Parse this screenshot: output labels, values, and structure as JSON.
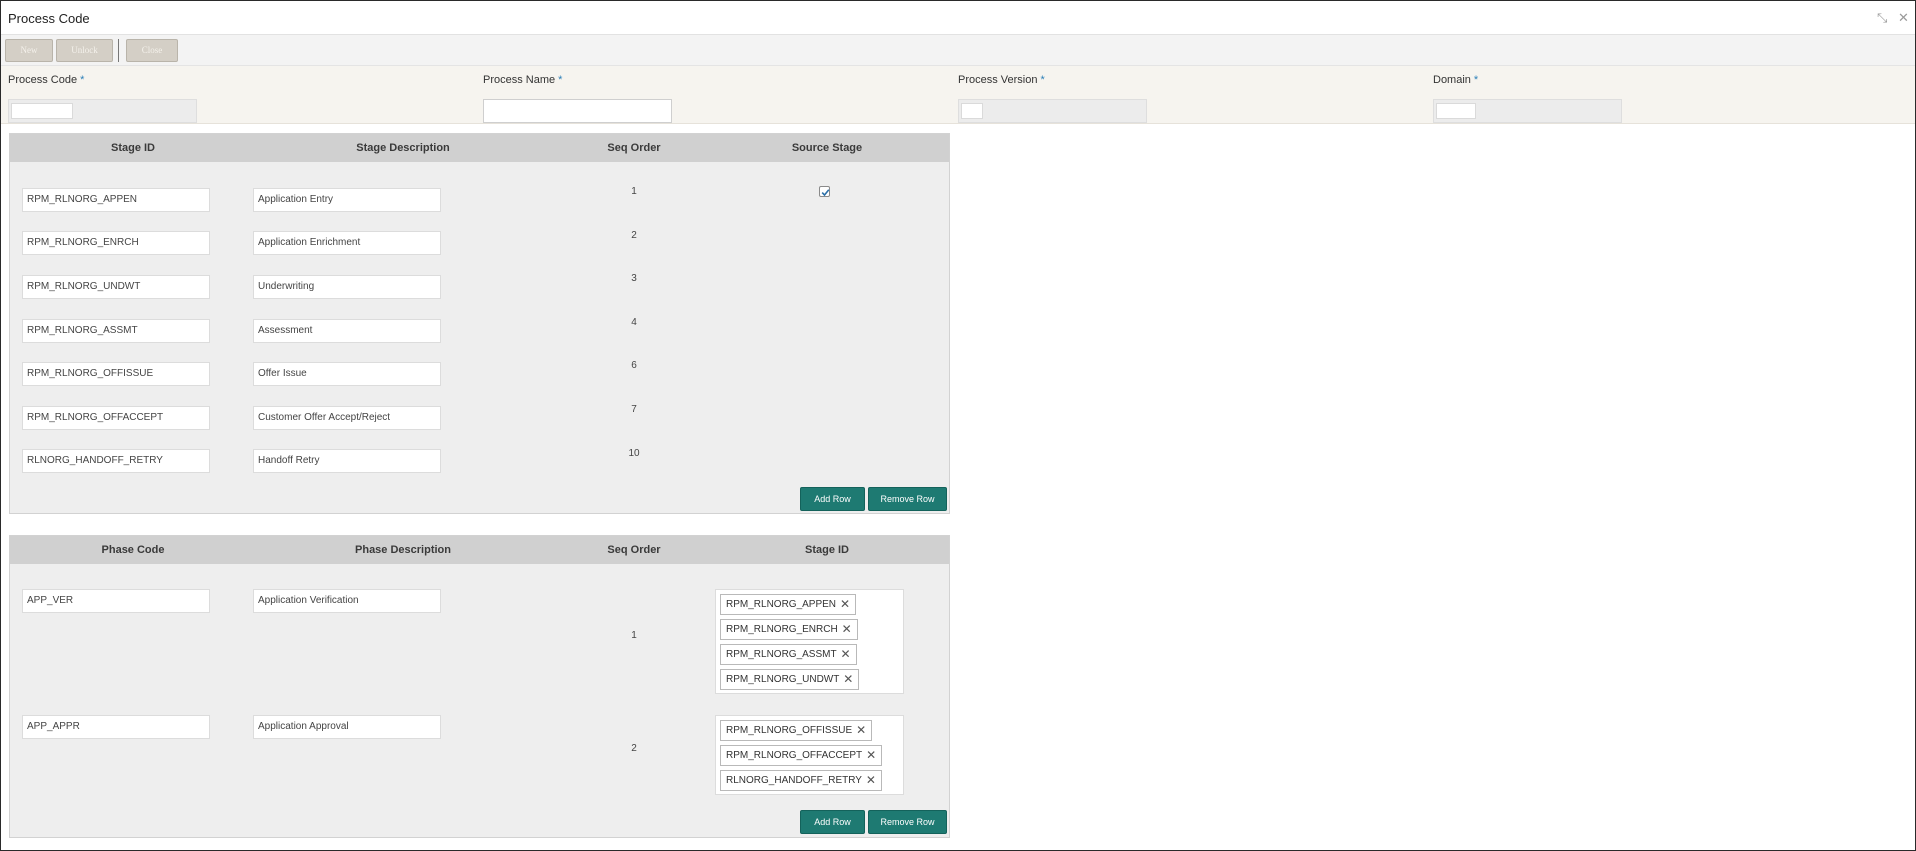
{
  "window": {
    "title": "Process Code",
    "restore_glyph": "⤡",
    "close_glyph": "✕"
  },
  "toolbar": {
    "new_label": "New",
    "unlock_label": "Unlock",
    "close_label": "Close"
  },
  "header": {
    "required_mark": "*",
    "fields": [
      {
        "label": "Process Code"
      },
      {
        "label": "Process Name"
      },
      {
        "label": "Process Version"
      },
      {
        "label": "Domain"
      }
    ]
  },
  "stages": {
    "columns": [
      "Stage ID",
      "Stage Description",
      "Seq Order",
      "Source Stage"
    ],
    "rows": [
      {
        "stage_id": "RPM_RLNORG_APPEN",
        "description": "Application Entry",
        "seq": "1",
        "source": true
      },
      {
        "stage_id": "RPM_RLNORG_ENRCH",
        "description": "Application Enrichment",
        "seq": "2",
        "source": false
      },
      {
        "stage_id": "RPM_RLNORG_UNDWT",
        "description": "Underwriting",
        "seq": "3",
        "source": false
      },
      {
        "stage_id": "RPM_RLNORG_ASSMT",
        "description": "Assessment",
        "seq": "4",
        "source": false
      },
      {
        "stage_id": "RPM_RLNORG_OFFISSUE",
        "description": "Offer Issue",
        "seq": "6",
        "source": false
      },
      {
        "stage_id": "RPM_RLNORG_OFFACCEPT",
        "description": "Customer Offer Accept/Reject",
        "seq": "7",
        "source": false
      },
      {
        "stage_id": "RLNORG_HANDOFF_RETRY",
        "description": "Handoff Retry",
        "seq": "10",
        "source": false
      }
    ],
    "add_row_label": "Add Row",
    "remove_row_label": "Remove Row"
  },
  "phases": {
    "columns": [
      "Phase Code",
      "Phase Description",
      "Seq Order",
      "Stage ID"
    ],
    "rows": [
      {
        "code": "APP_VER",
        "description": "Application Verification",
        "seq": "1",
        "stages": [
          "RPM_RLNORG_APPEN",
          "RPM_RLNORG_ENRCH",
          "RPM_RLNORG_ASSMT",
          "RPM_RLNORG_UNDWT"
        ]
      },
      {
        "code": "APP_APPR",
        "description": "Application Approval",
        "seq": "2",
        "stages": [
          "RPM_RLNORG_OFFISSUE",
          "RPM_RLNORG_OFFACCEPT",
          "RLNORG_HANDOFF_RETRY"
        ]
      }
    ],
    "add_row_label": "Add Row",
    "remove_row_label": "Remove Row",
    "tag_remove_glyph": "✕"
  }
}
